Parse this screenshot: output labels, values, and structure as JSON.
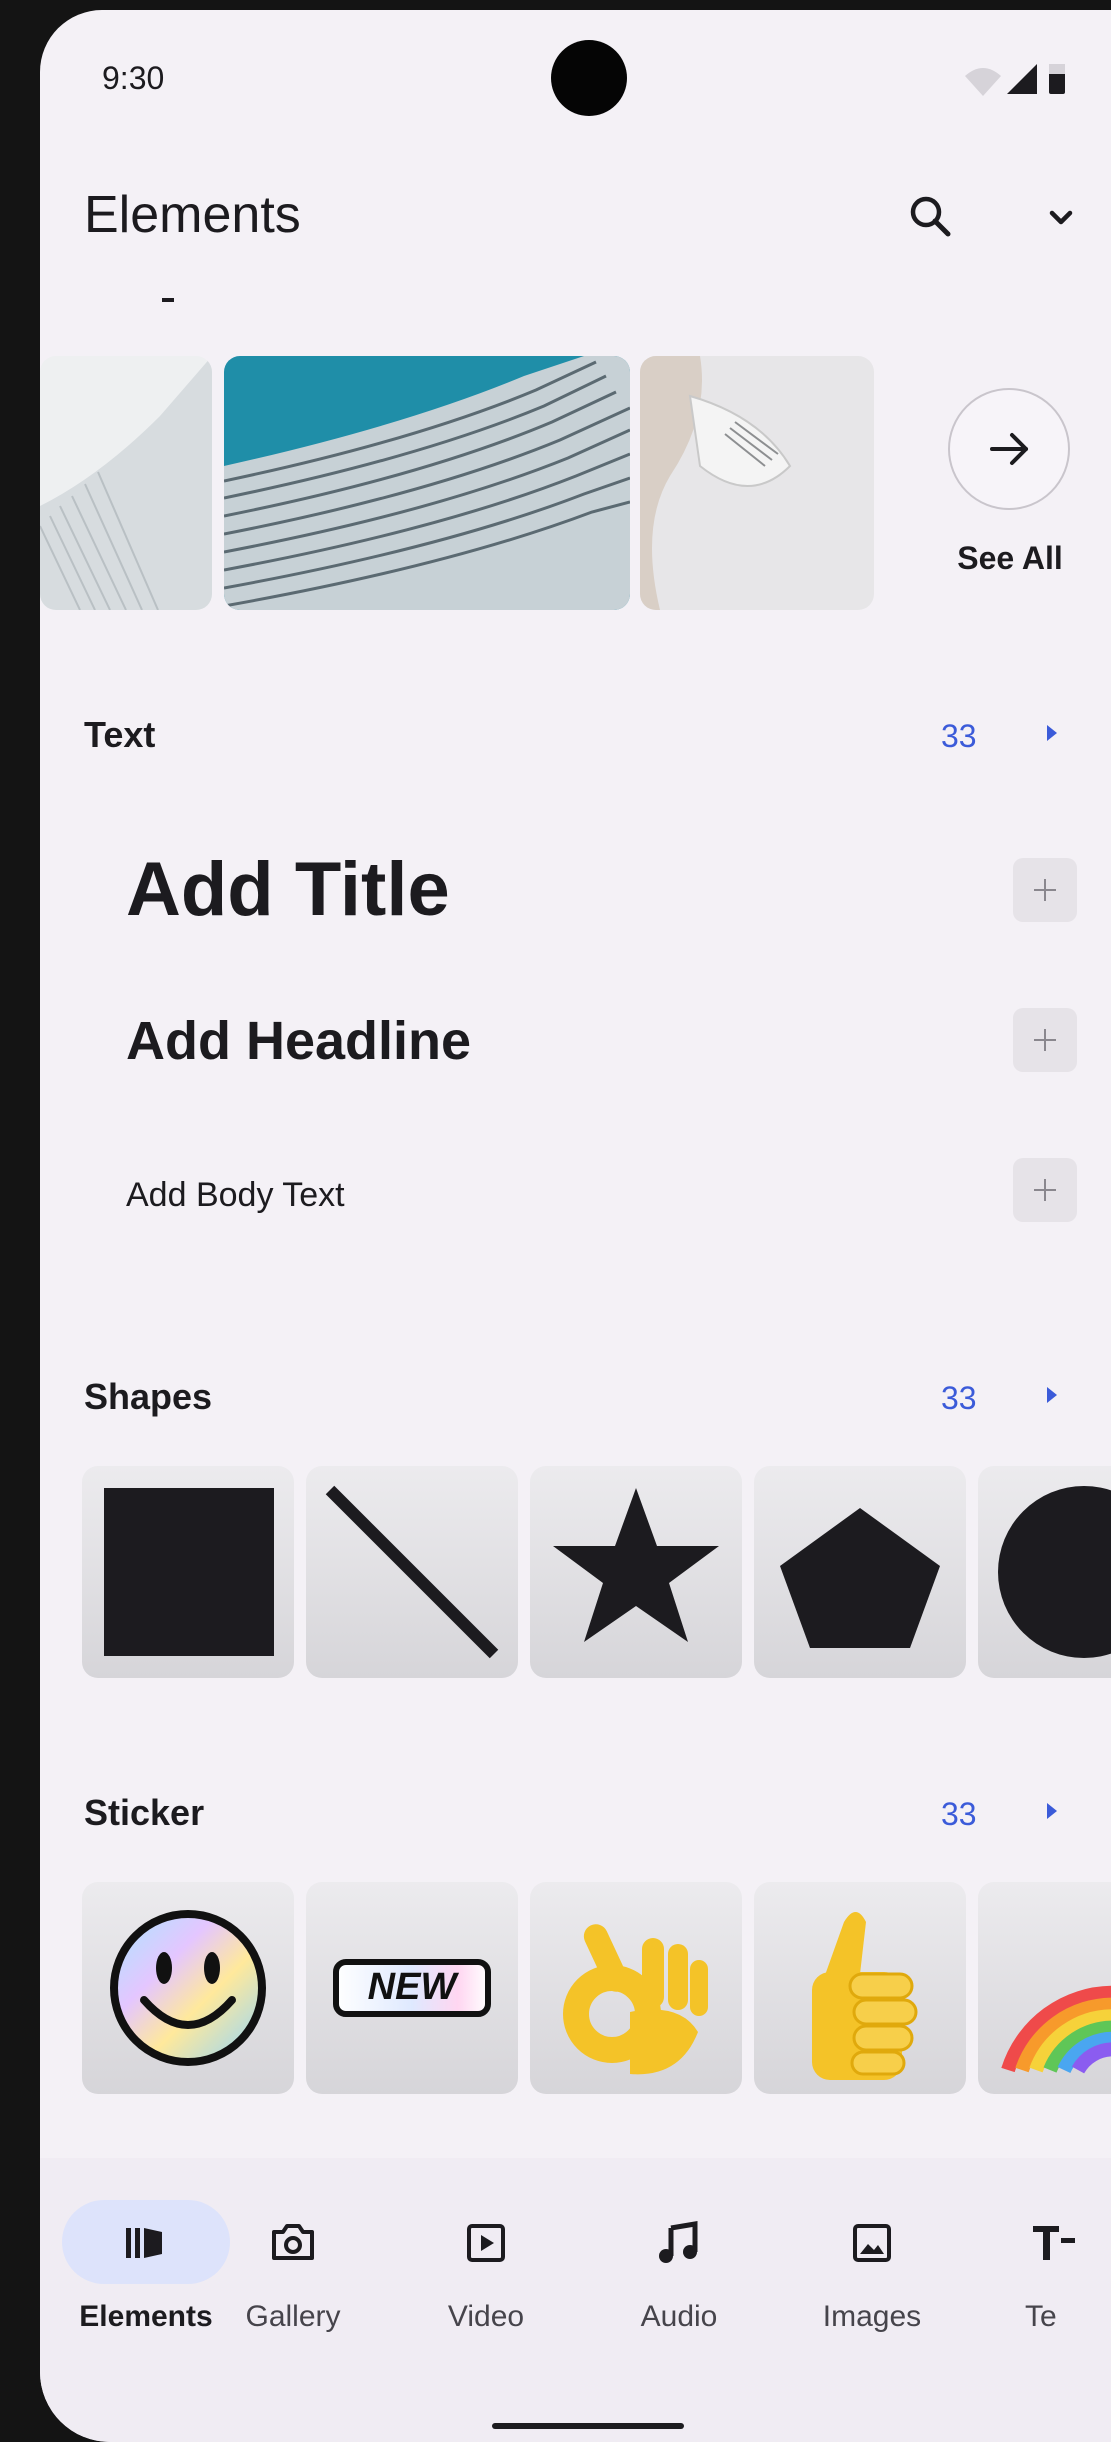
{
  "status": {
    "time": "9:30"
  },
  "app": {
    "title": "Elements"
  },
  "photos": {
    "see_all": "See All"
  },
  "sections": [
    {
      "title": "Text",
      "count": "33"
    },
    {
      "title": "Shapes",
      "count": "33"
    },
    {
      "title": "Sticker",
      "count": "33"
    }
  ],
  "text_items": [
    {
      "label": "Add Title"
    },
    {
      "label": "Add Headline"
    },
    {
      "label": "Add Body Text"
    }
  ],
  "shapes": [
    "square-icon",
    "line-icon",
    "star-icon",
    "pentagon-icon",
    "circle-icon"
  ],
  "stickers": {
    "new_badge": "NEW",
    "items": [
      "smiley-sticker",
      "new-sticker",
      "ok-hand-sticker",
      "thumbs-up-sticker",
      "rainbow-sticker"
    ]
  },
  "nav": {
    "items": [
      {
        "label": "Elements",
        "icon": "elements-icon"
      },
      {
        "label": "Gallery",
        "icon": "camera-icon"
      },
      {
        "label": "Video",
        "icon": "video-icon"
      },
      {
        "label": "Audio",
        "icon": "music-note-icon"
      },
      {
        "label": "Images",
        "icon": "image-icon"
      },
      {
        "label": "Te",
        "icon": "text-icon"
      }
    ]
  },
  "colors": {
    "accent": "#3b5bd9",
    "background": "#f4f1f6",
    "nav_selected": "#dde3fb"
  }
}
